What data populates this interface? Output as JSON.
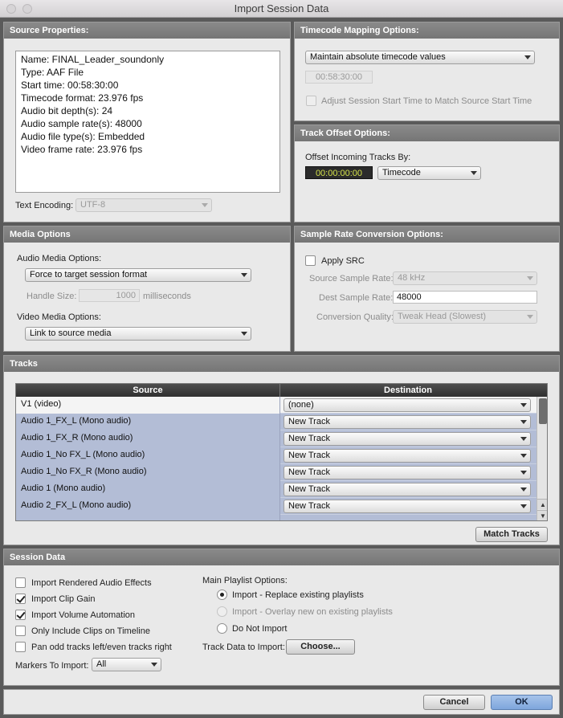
{
  "window": {
    "title": "Import Session Data"
  },
  "source_properties": {
    "header": "Source Properties:",
    "lines": [
      "Name: FINAL_Leader_soundonly",
      "Type: AAF File",
      "Start time: 00:58:30:00",
      "Timecode format: 23.976 fps",
      "Audio bit depth(s): 24",
      "Audio sample rate(s): 48000",
      "Audio file type(s): Embedded",
      "Video frame rate: 23.976 fps"
    ],
    "text_encoding_label": "Text Encoding:",
    "text_encoding_value": "UTF-8"
  },
  "timecode_mapping": {
    "header": "Timecode Mapping Options:",
    "mode": "Maintain absolute timecode values",
    "timecode": "00:58:30:00",
    "adjust_label": "Adjust Session Start Time to Match Source Start Time"
  },
  "track_offset": {
    "header": "Track Offset Options:",
    "label": "Offset Incoming Tracks By:",
    "value": "00:00:00:00",
    "unit": "Timecode"
  },
  "media_options": {
    "header": "Media Options",
    "audio_label": "Audio Media Options:",
    "audio_value": "Force to target session format",
    "handle_label": "Handle Size:",
    "handle_value": "1000",
    "handle_unit": "milliseconds",
    "video_label": "Video Media Options:",
    "video_value": "Link to source media"
  },
  "src": {
    "header": "Sample Rate Conversion Options:",
    "apply_label": "Apply SRC",
    "source_rate_label": "Source Sample Rate:",
    "source_rate_value": "48 kHz",
    "dest_rate_label": "Dest Sample Rate:",
    "dest_rate_value": "48000",
    "quality_label": "Conversion Quality:",
    "quality_value": "Tweak Head (Slowest)"
  },
  "tracks": {
    "header": "Tracks",
    "col_source": "Source",
    "col_destination": "Destination",
    "rows": [
      {
        "source": "V1 (video)",
        "destination": "(none)"
      },
      {
        "source": "Audio 1_FX_L (Mono audio)",
        "destination": "New Track"
      },
      {
        "source": "Audio 1_FX_R (Mono audio)",
        "destination": "New Track"
      },
      {
        "source": "Audio 1_No FX_L (Mono audio)",
        "destination": "New Track"
      },
      {
        "source": "Audio 1_No FX_R (Mono audio)",
        "destination": "New Track"
      },
      {
        "source": "Audio 1 (Mono audio)",
        "destination": "New Track"
      },
      {
        "source": "Audio 2_FX_L (Mono audio)",
        "destination": "New Track"
      }
    ],
    "match_button": "Match Tracks"
  },
  "session_data": {
    "header": "Session Data",
    "options": [
      {
        "label": "Import Rendered Audio Effects",
        "checked": false
      },
      {
        "label": "Import Clip Gain",
        "checked": true
      },
      {
        "label": "Import Volume Automation",
        "checked": true
      },
      {
        "label": "Only Include Clips on Timeline",
        "checked": false
      },
      {
        "label": "Pan odd tracks left/even tracks right",
        "checked": false
      }
    ],
    "markers_label": "Markers To Import:",
    "markers_value": "All",
    "playlist_label": "Main Playlist Options:",
    "playlist_options": [
      {
        "label": "Import - Replace existing playlists",
        "selected": true,
        "enabled": true
      },
      {
        "label": "Import - Overlay new on existing playlists",
        "selected": false,
        "enabled": false
      },
      {
        "label": "Do Not Import",
        "selected": false,
        "enabled": true
      }
    ],
    "track_data_label": "Track Data to Import:",
    "choose_button": "Choose..."
  },
  "footer": {
    "cancel": "Cancel",
    "ok": "OK"
  }
}
